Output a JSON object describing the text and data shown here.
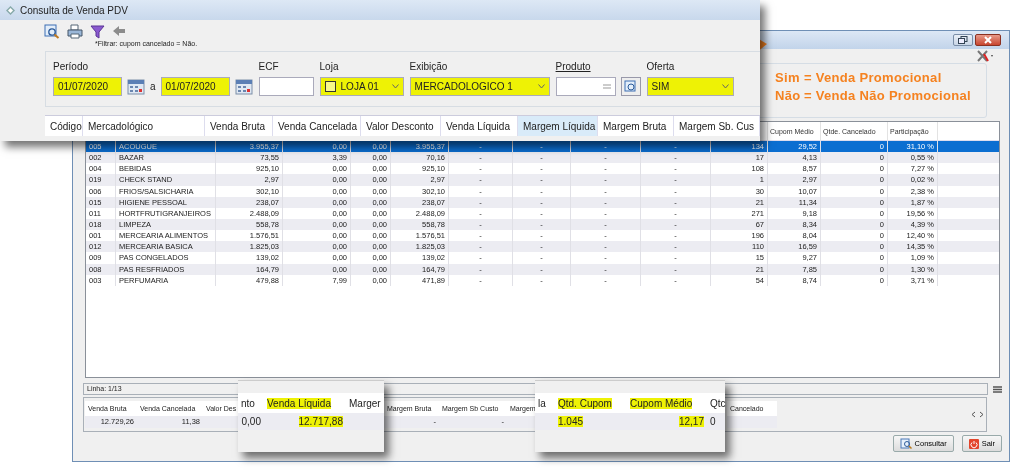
{
  "top_panel": {
    "title": "Consulta de Venda PDV",
    "filter_note": "*Filtrar: cupom cancelado = Não.",
    "period": {
      "label": "Período",
      "from": "01/07/2020",
      "separator": "a",
      "to": "01/07/2020",
      "highlighted": true
    },
    "ecf": {
      "label": "ECF"
    },
    "store": {
      "label": "Loja",
      "value": "LOJA 01",
      "checked": false,
      "highlighted": true
    },
    "display": {
      "label": "Exibição",
      "value": "MERCADOLOGICO 1",
      "highlighted": true
    },
    "product": {
      "label": "Produto"
    },
    "offer": {
      "label": "Oferta",
      "value": "SIM",
      "highlighted": true
    },
    "columns": [
      {
        "label": "Código",
        "hovered": false
      },
      {
        "label": "Mercadológico",
        "hovered": false
      },
      {
        "label": "Venda Bruta",
        "hovered": false
      },
      {
        "label": "Venda Cancelada",
        "hovered": false
      },
      {
        "label": "Valor Desconto",
        "hovered": false
      },
      {
        "label": "Venda Líquida",
        "hovered": false
      },
      {
        "label": "Margem Líquida",
        "hovered": true
      },
      {
        "label": "Margem Bruta",
        "hovered": false
      },
      {
        "label": "Margem Sb. Cus",
        "hovered": false
      }
    ]
  },
  "annotation": [
    {
      "key": "Sim",
      "text": "= Venda Promocional"
    },
    {
      "key": "Não",
      "text": "= Venda Não Promocional"
    }
  ],
  "window": {
    "table": {
      "columns": [
        "",
        "",
        "",
        "",
        "",
        "",
        "",
        "",
        "",
        "",
        "",
        "Cupom Médio",
        "Qtde. Cancelado",
        "Participação"
      ],
      "rows": [
        {
          "selected": true,
          "cells": [
            "005",
            "ACOUGUE",
            "3.955,37",
            "0,00",
            "0,00",
            "3.955,37",
            "-",
            "-",
            "-",
            "-",
            "134",
            "29,52",
            "0",
            "31,10 %"
          ]
        },
        {
          "selected": false,
          "cells": [
            "002",
            "BAZAR",
            "73,55",
            "3,39",
            "0,00",
            "70,16",
            "-",
            "-",
            "-",
            "-",
            "17",
            "4,13",
            "0",
            "0,55 %"
          ]
        },
        {
          "selected": false,
          "cells": [
            "004",
            "BEBIDAS",
            "925,10",
            "0,00",
            "0,00",
            "925,10",
            "-",
            "-",
            "-",
            "-",
            "108",
            "8,57",
            "0",
            "7,27 %"
          ]
        },
        {
          "selected": false,
          "cells": [
            "019",
            "CHECK STAND",
            "2,97",
            "0,00",
            "0,00",
            "2,97",
            "-",
            "-",
            "-",
            "-",
            "1",
            "2,97",
            "0",
            "0,02 %"
          ]
        },
        {
          "selected": false,
          "cells": [
            "006",
            "FRIOS/SALSICHARIA",
            "302,10",
            "0,00",
            "0,00",
            "302,10",
            "-",
            "-",
            "-",
            "-",
            "30",
            "10,07",
            "0",
            "2,38 %"
          ]
        },
        {
          "selected": false,
          "cells": [
            "015",
            "HIGIENE PESSOAL",
            "238,07",
            "0,00",
            "0,00",
            "238,07",
            "-",
            "-",
            "-",
            "-",
            "21",
            "11,34",
            "0",
            "1,87 %"
          ]
        },
        {
          "selected": false,
          "cells": [
            "011",
            "HORTFRUTIGRANJEIROS",
            "2.488,09",
            "0,00",
            "0,00",
            "2.488,09",
            "-",
            "-",
            "-",
            "-",
            "271",
            "9,18",
            "0",
            "19,56 %"
          ]
        },
        {
          "selected": false,
          "cells": [
            "018",
            "LIMPEZA",
            "558,78",
            "0,00",
            "0,00",
            "558,78",
            "-",
            "-",
            "-",
            "-",
            "67",
            "8,34",
            "0",
            "4,39 %"
          ]
        },
        {
          "selected": false,
          "cells": [
            "001",
            "MERCEARIA ALIMENTOS",
            "1.576,51",
            "0,00",
            "0,00",
            "1.576,51",
            "-",
            "-",
            "-",
            "-",
            "196",
            "8,04",
            "0",
            "12,40 %"
          ]
        },
        {
          "selected": false,
          "cells": [
            "012",
            "MERCEARIA BASICA",
            "1.825,03",
            "0,00",
            "0,00",
            "1.825,03",
            "-",
            "-",
            "-",
            "-",
            "110",
            "16,59",
            "0",
            "14,35 %"
          ]
        },
        {
          "selected": false,
          "cells": [
            "009",
            "PAS CONGELADOS",
            "139,02",
            "0,00",
            "0,00",
            "139,02",
            "-",
            "-",
            "-",
            "-",
            "15",
            "9,27",
            "0",
            "1,09 %"
          ]
        },
        {
          "selected": false,
          "cells": [
            "008",
            "PAS RESFRIADOS",
            "164,79",
            "0,00",
            "0,00",
            "164,79",
            "-",
            "-",
            "-",
            "-",
            "21",
            "7,85",
            "0",
            "1,30 %"
          ]
        },
        {
          "selected": false,
          "cells": [
            "003",
            "PERFUMARIA",
            "479,88",
            "7,99",
            "0,00",
            "471,89",
            "-",
            "-",
            "-",
            "-",
            "54",
            "8,74",
            "0",
            "3,71 %"
          ]
        }
      ]
    },
    "row_status": "Linha: 1/13",
    "summary_start": [
      {
        "label": "Venda Bruta",
        "value": "12.729,26"
      },
      {
        "label": "Venda Cancelada",
        "value": "11,38"
      },
      {
        "label": "Valor Des"
      }
    ],
    "summary_mid": [
      {
        "label": "Margem Bruta",
        "value": "-"
      },
      {
        "label": "Margem Sb Custo",
        "value": "-"
      },
      {
        "label": "Margem"
      }
    ],
    "summary_end": [
      {
        "label": "Cancelado"
      }
    ],
    "buttons": [
      {
        "kind": "search",
        "label": "Consultar"
      },
      {
        "kind": "exit",
        "label": "Sair"
      }
    ]
  },
  "callouts": [
    {
      "columns": [
        {
          "label": "nto",
          "value": "0,00",
          "highlighted": false
        },
        {
          "label": "Venda Líquida",
          "value": "12.717,88",
          "highlighted": true
        },
        {
          "label": "Marger",
          "highlighted": false
        }
      ]
    },
    {
      "columns": [
        {
          "label": "la",
          "highlighted": false
        },
        {
          "label": "Qtd. Cupom",
          "value": "1.045",
          "highlighted": true
        },
        {
          "label": "Cupom Médio",
          "value": "12,17",
          "highlighted": true
        },
        {
          "label": "Qtc",
          "value": "0",
          "highlighted": false
        }
      ]
    }
  ]
}
